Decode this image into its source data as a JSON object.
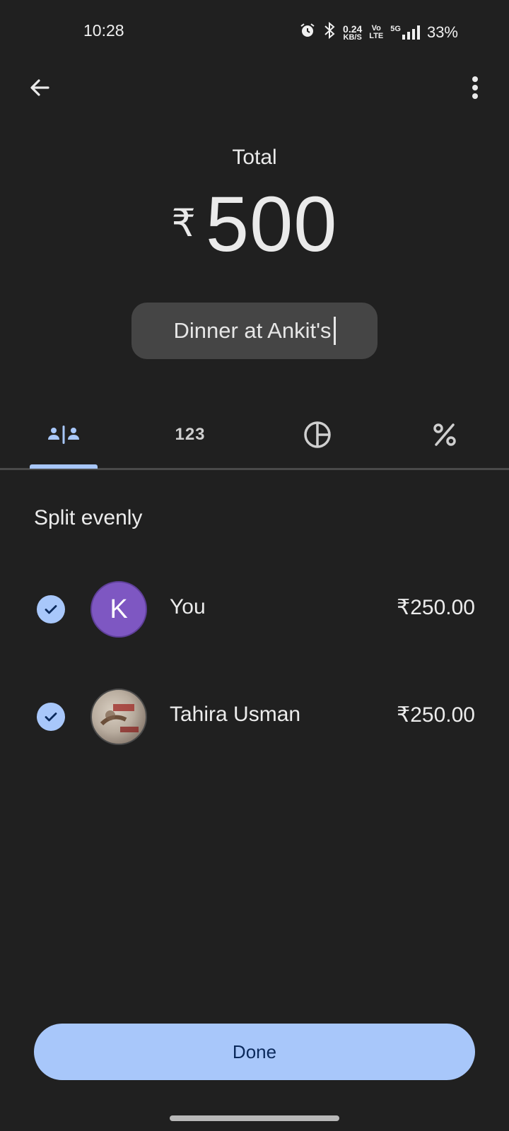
{
  "status_bar": {
    "time": "10:28",
    "net_speed_value": "0.24",
    "net_speed_unit": "KB/S",
    "volte_top": "Vo",
    "volte_bottom": "LTE",
    "network": "5G",
    "battery": "33%"
  },
  "header": {
    "back_icon": "arrow-back-icon",
    "more_icon": "more-vert-icon"
  },
  "total": {
    "label": "Total",
    "currency_symbol": "₹",
    "amount": "500"
  },
  "description": {
    "value": "Dinner at Ankit's"
  },
  "tabs": [
    {
      "icon": "split-equally-icon",
      "selected": true
    },
    {
      "icon": "numbers-123-icon",
      "label": "123",
      "selected": false
    },
    {
      "icon": "pie-chart-icon",
      "selected": false
    },
    {
      "icon": "percent-icon",
      "selected": false
    }
  ],
  "section": {
    "title": "Split evenly"
  },
  "participants": [
    {
      "name": "You",
      "avatar_letter": "K",
      "share": "₹250.00",
      "checked": true
    },
    {
      "name": "Tahira Usman",
      "avatar_letter": "",
      "share": "₹250.00",
      "checked": true
    }
  ],
  "colors": {
    "background": "#202020",
    "accent": "#a8c7fa",
    "avatar_k": "#7e57c2"
  },
  "done_button": {
    "label": "Done"
  }
}
